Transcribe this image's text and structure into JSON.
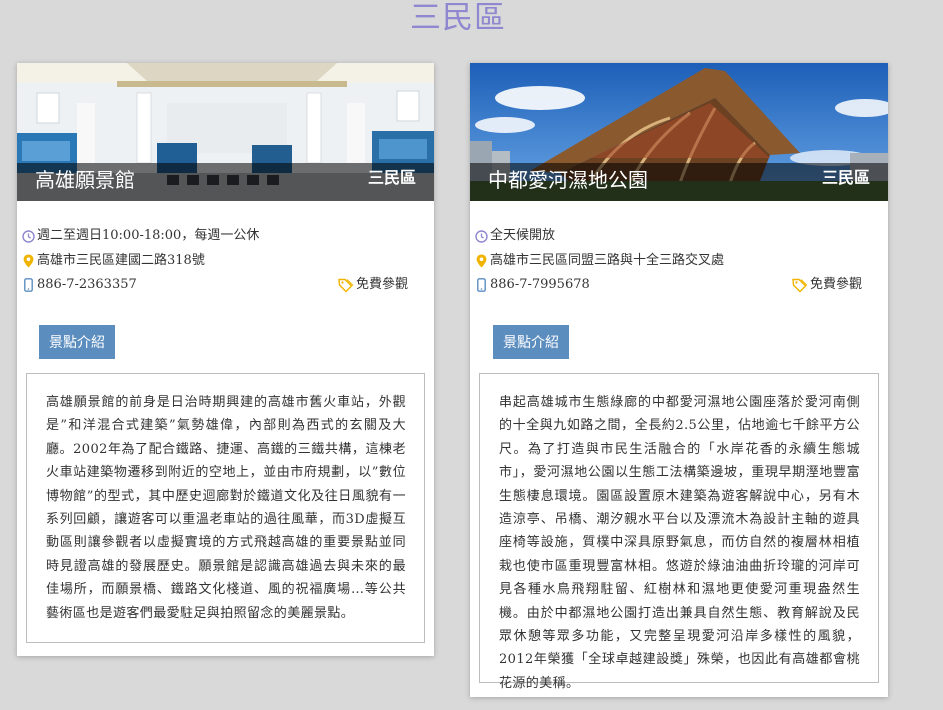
{
  "district_title": "三民區",
  "colors": {
    "title": "#8f87cf",
    "button": "#5b8dbf",
    "clock_icon": "#8f87cf",
    "pin_icon": "#f0b400",
    "phone_icon": "#5b8dbf",
    "tag_icon": "#f0b400"
  },
  "cards": [
    {
      "name": "高雄願景館",
      "district": "三民區",
      "hours": "週二至週日10:00-18:00，每週一公休",
      "address": "高雄市三民區建國二路318號",
      "phone": "886-7-2363357",
      "fee": "免費參觀",
      "button_label": "景點介紹",
      "description": "高雄願景館的前身是日治時期興建的高雄市舊火車站，外觀是”和洋混合式建築”氣勢雄偉，內部則為西式的玄關及大廳。2002年為了配合鐵路、捷運、高鐵的三鐵共構，這棟老火車站建築物遷移到附近的空地上，並由市府規劃，以”數位博物館”的型式，其中歷史迴廊對於鐵道文化及往日風貌有一系列回顧，讓遊客可以重溫老車站的過往風華，而3D虛擬互動區則讓參觀者以虛擬實境的方式飛越高雄的重要景點並同時見證高雄的發展歷史。願景館是認識高雄過去與未來的最佳場所，而願景橋、鐵路文化棧道、風的祝福廣場…等公共藝術區也是遊客們最愛駐足與拍照留念的美麗景點。"
    },
    {
      "name": "中都愛河濕地公園",
      "district": "三民區",
      "hours": "全天候開放",
      "address": "高雄市三民區同盟三路與十全三路交叉處",
      "phone": "886-7-7995678",
      "fee": "免費參觀",
      "button_label": "景點介紹",
      "description": "串起高雄城市生態綠廊的中都愛河濕地公園座落於愛河南側的十全與九如路之間，全長約2.5公里，佔地逾七千餘平方公尺。為了打造與市民生活融合的「水岸花香的永續生態城市」，愛河濕地公園以生態工法構築邊坡，重現早期溼地豐富生態棲息環境。園區設置原木建築為遊客解說中心，另有木造涼亭、吊橋、潮汐親水平台以及漂流木為設計主軸的遊具座椅等設施，質樸中深具原野氣息，而仿自然的複層林相植栽也使市區重現豐富林相。悠遊於綠油油曲折玲瓏的河岸可見各種水鳥飛翔駐留、紅樹林和濕地更使愛河重現盎然生機。由於中都濕地公園打造出兼具自然生態、教育解說及民眾休憩等眾多功能，又完整呈現愛河沿岸多樣性的風貌，2012年榮獲「全球卓越建設獎」殊榮，也因此有高雄都會桃花源的美稱。"
    }
  ]
}
